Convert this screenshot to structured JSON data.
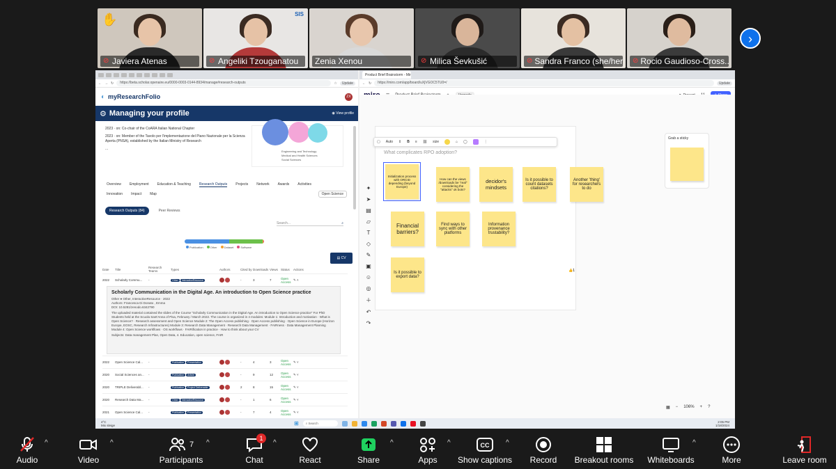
{
  "participants": [
    {
      "name": "Javiera Atenas",
      "muted": true,
      "hand_raised": true,
      "bg": "#cfc7bd",
      "shirt": "#2a2a2a",
      "hair": "#3a2a20",
      "skin": "#e7c4a8"
    },
    {
      "name": "Angeliki Tzouganatou",
      "muted": true,
      "bg": "#e8e6e4",
      "shirt": "#b43a3a",
      "hair": "#3b2b22",
      "skin": "#e6c2a6",
      "logo": "SIS"
    },
    {
      "name": "Zenia Xenou",
      "muted": false,
      "active": true,
      "bg": "#d9d4cf",
      "shirt": "#d9d9d9",
      "hair": "#5a3b2a",
      "skin": "#e8c6ac"
    },
    {
      "name": "Milica Ševkušić",
      "muted": true,
      "bg": "#4a4a4a",
      "shirt": "#2b2b2b",
      "hair": "#1f1a18",
      "skin": "#d9b59a"
    },
    {
      "name": "Sandra Franco (she/her)",
      "muted": true,
      "bg": "#e7e3dc",
      "shirt": "#3a3a3a",
      "hair": "#3b2b22",
      "skin": "#e4c1a3"
    },
    {
      "name": "Rocio Gaudioso-Cross...",
      "muted": true,
      "bg": "#d6d2cc",
      "shirt": "#3b3b3b",
      "hair": "#2a1f18",
      "skin": "#dfbb9f"
    }
  ],
  "left_window": {
    "url": "https://beta.scholar.openaire.eu/0000-0003-0144-8934/manage#research-outputs",
    "update_label": "Update",
    "brand": "myResearchFolio",
    "avatar": "ZX",
    "bar_title": "Managing your profile",
    "view_profile": "View profile",
    "cv_lines": [
      "2023 · on: Co-chair of the CoARA Italian National Chapter",
      "2023 · on: Member of the Tavolo per l'implementazione del Piano Nazionale per la Scienza Aperta (PNSA), established by the Italian Ministry of Research"
    ],
    "pie_legend": [
      "Engineering and Technology",
      "Medical and Health Sciences",
      "Social Sciences"
    ],
    "tabs_row1": [
      "Overview",
      "Employment",
      "Education & Teaching",
      "Research Outputs",
      "Projects",
      "Network",
      "Awards",
      "Activities"
    ],
    "tabs_row2": [
      "Innovation",
      "Impact",
      "Map"
    ],
    "open_science": "Open Science",
    "pill_on": "Research Outputs (84)",
    "pill_off": "Peer Reviews",
    "search_placeholder": "Search...",
    "legend": [
      "Publication",
      "Other",
      "Dataset",
      "Software"
    ],
    "cv_button": "CV",
    "headers": [
      "Date",
      "Title",
      "Research Teams",
      "Types",
      "Authors",
      "Cited by",
      "Downloads",
      "Views",
      "Status",
      "Actions"
    ],
    "first_row": {
      "date": "2022",
      "title": "Scholarly Commu...",
      "team": "-",
      "types": [
        "Other",
        "InteractiveResource"
      ],
      "cited": "-",
      "dl": "3",
      "views": "7",
      "status": "Open Access"
    },
    "detail": {
      "title": "Scholarly Communication in the Digital Age. An introduction to Open Science practice",
      "meta": "Other ● Other, InteractiveResource · 2022",
      "authors": "Authors: Francesca Di Donato , Emma",
      "doi": "DOI: 10.5281/zenodo.6342790",
      "desc": "The uploaded material contained the slides of the Course \"Scholarly Communication in the Digital Age. An introduction to Open Science practice\" For PhD Students held at the Scuola Sant'Anna of Pisa, February / March 2022. The course is organized in 4 modules: Module 1: Introduction and motivation · What is Open Science? · Research assessment and Open Science Module 2: The Open Access publishing · Open Access publishing · Open Science in Europe (Horizon Europe, EOSC, Research Infrastructures) Module 3: Research Data Management · Research Data Management · FAIRness · Data Management Planning Module 4: Open Science workflows · OS workflows · FAIRification in practice · How to think about your CV",
      "subjects": "Subjects: Data management Plan, Open Data, 4. Education, open science, FAIR"
    },
    "rows": [
      {
        "date": "2022",
        "title": "Open Science Cal...",
        "team": "-",
        "types": [
          "Publication",
          "Presentation"
        ],
        "cited": "-",
        "dl": "4",
        "views": "3",
        "status": "Open Access"
      },
      {
        "date": "2020",
        "title": "Social Sciences an...",
        "team": "-",
        "types": [
          "Publication",
          "Article"
        ],
        "cited": "-",
        "dl": "9",
        "views": "12",
        "status": "Open Access"
      },
      {
        "date": "2020",
        "title": "TRIPLE Deliverabl...",
        "team": "-",
        "types": [
          "Publication",
          "Project Deliverable"
        ],
        "cited": "2",
        "dl": "8",
        "views": "15",
        "status": "Open Access"
      },
      {
        "date": "2020",
        "title": "Research Data Ma...",
        "team": "-",
        "types": [
          "Other",
          "InteractiveResource"
        ],
        "cited": "-",
        "dl": "1",
        "views": "6",
        "status": "Open Access"
      },
      {
        "date": "2021",
        "title": "Open Science Cal...",
        "team": "-",
        "types": [
          "Publication",
          "Presentation"
        ],
        "cited": "-",
        "dl": "7",
        "views": "4",
        "status": "Open Access"
      }
    ]
  },
  "right_window": {
    "tab_title": "Product Brief Brainstorm - Miro",
    "url": "https://miro.com/app/board/uXjVGOC5TU0=/",
    "update_label": "Update",
    "logo": "miro",
    "board_name": "Product Brief Brainstorm",
    "upgrade": "Upgrade",
    "present": "Present",
    "share": "Share",
    "share_count": "11",
    "toolbar": {
      "font": "Auto",
      "size": "size"
    },
    "question": "What complicates RPO adoption?",
    "stickies": [
      "Initialization process with ORCID depending (beyond Europe)",
      "How can the views /downloads be \"real\" considering the \"attacks\" ok bots?",
      "decidor's mindsets",
      "Is it possible to count datasets citations?",
      "Another 'thing' for researchers to do",
      "Financial barriers?",
      "Find ways to sync with other platforms",
      "Information provenance trustability?",
      "Is it possible to export data?"
    ],
    "grab_label": "Grab a sticky",
    "zoom": "106%",
    "reaction": "1"
  },
  "taskbar": {
    "weather_temp": "4°C",
    "weather_desc": "Mix sleige",
    "search": "Search",
    "time": "2:05 PM",
    "date": "1/18/2024"
  },
  "zoom_toolbar": [
    {
      "label": "Audio",
      "caret": true
    },
    {
      "label": "Video",
      "caret": true
    },
    {
      "label": "Participants",
      "count": "7",
      "caret": true
    },
    {
      "label": "Chat",
      "badge": "1",
      "caret": true
    },
    {
      "label": "React"
    },
    {
      "label": "Share",
      "caret": true
    },
    {
      "label": "Apps",
      "caret": true
    },
    {
      "label": "Show captions",
      "caret": true
    },
    {
      "label": "Record"
    },
    {
      "label": "Breakout rooms"
    },
    {
      "label": "Whiteboards",
      "caret": true
    },
    {
      "label": "More"
    },
    {
      "label": "Leave room"
    }
  ],
  "colors": {
    "accent": "#163768",
    "miro_blue": "#4262ff",
    "sticky": "#fde68a",
    "zoom_blue": "#0e71eb",
    "active": "#3bd16f",
    "mute_red": "#ff3b3b"
  }
}
